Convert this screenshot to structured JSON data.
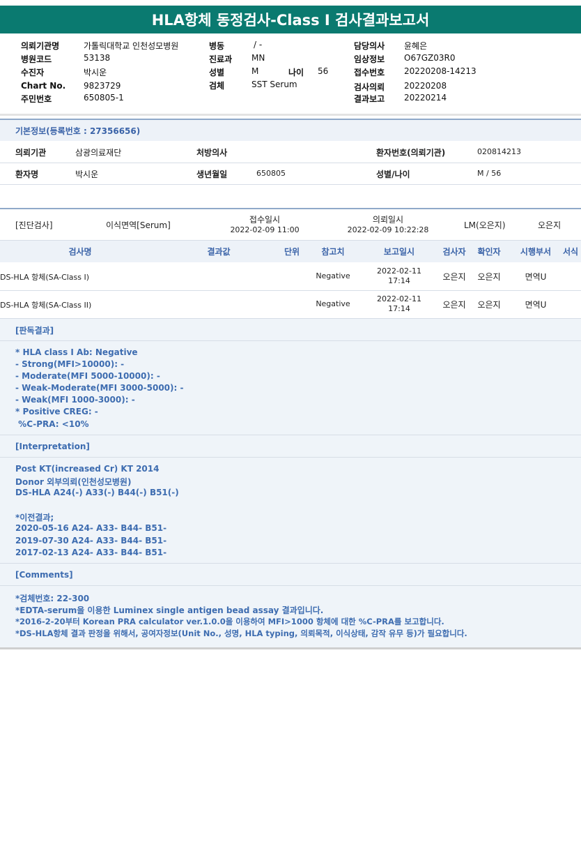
{
  "title": "HLA항체 동정검사-Class I 검사결과보고서",
  "header": {
    "col1": [
      {
        "label": "의뢰기관명",
        "value": "가톨릭대학교 인천성모병원"
      },
      {
        "label": "병원코드",
        "value": "53138"
      },
      {
        "label": "수진자",
        "value": "박시운"
      },
      {
        "label": "Chart No.",
        "value": "9823729"
      },
      {
        "label": "주민번호",
        "value": "650805-1"
      }
    ],
    "col2": [
      {
        "label": "병동",
        "value": "/ -"
      },
      {
        "label": "진료과",
        "value": "MN"
      },
      {
        "label": "성별",
        "value": "M"
      },
      {
        "label": "검체",
        "value": "SST Serum"
      }
    ],
    "age": {
      "label": "나이",
      "value": "56"
    },
    "col3": [
      {
        "label": "담당의사",
        "value": "윤혜은"
      },
      {
        "label": "임상정보",
        "value": "O67GZ03R0"
      },
      {
        "label": "접수번호",
        "value": "20220208-14213"
      },
      {
        "label": "검사의뢰",
        "value": "20220208"
      },
      {
        "label": "결과보고",
        "value": "20220214"
      }
    ]
  },
  "basic": {
    "title": "기본정보(등록번호 : 27356656)",
    "row1": {
      "inst_label": "의뢰기관",
      "inst_value": "삼광의료재단",
      "doctor_label": "처방의사",
      "doctor_value": "",
      "pid_label": "환자번호(의뢰기관)",
      "pid_value": "020814213"
    },
    "row2": {
      "name_label": "환자명",
      "name_value": "박시운",
      "dob_label": "생년월일",
      "dob_value": "650805",
      "sex_label": "성별/나이",
      "sex_value": "M / 56"
    }
  },
  "exam_info": {
    "category": "[진단검사]",
    "dept": "이식면역[Serum]",
    "received_label": "접수일시",
    "received_value": "2022-02-09 11:00",
    "requested_label": "의뢰일시",
    "requested_value": "2022-02-09 10:22:28",
    "lm": "LM(오은지)",
    "person": "오은지"
  },
  "table": {
    "headers": {
      "name": "검사명",
      "result": "결과값",
      "unit": "단위",
      "ref": "참고치",
      "report": "보고일시",
      "tester": "검사자",
      "confirmer": "확인자",
      "dept": "시행부서",
      "form": "서식"
    },
    "rows": [
      {
        "name": "DS-HLA 항체(SA-Class I)",
        "result": "",
        "unit": "",
        "ref": "Negative",
        "date": "2022-02-11",
        "time": "17:14",
        "tester": "오은지",
        "confirmer": "오은지",
        "dept": "면역U"
      },
      {
        "name": "DS-HLA 항체(SA-Class II)",
        "result": "",
        "unit": "",
        "ref": "Negative",
        "date": "2022-02-11",
        "time": "17:14",
        "tester": "오은지",
        "confirmer": "오은지",
        "dept": "면역U"
      }
    ]
  },
  "judgement": {
    "title": "[판독결과]",
    "lines": [
      "* HLA class I Ab: Negative",
      "- Strong(MFI>10000): -",
      "- Moderate(MFI 5000-10000): -",
      "- Weak-Moderate(MFI 3000-5000): -",
      "- Weak(MFI 1000-3000): -",
      "* Positive CREG: -",
      " %C-PRA: <10%"
    ]
  },
  "interpretation": {
    "title": "[Interpretation]",
    "lines": [
      "Post KT(increased Cr) KT 2014",
      "Donor 외부의뢰(인천성모병원)",
      "DS-HLA A24(-) A33(-) B44(-) B51(-)",
      "*이전결과;",
      "2020-05-16 A24- A33- B44- B51-",
      "2019-07-30 A24- A33- B44- B51-",
      "2017-02-13 A24- A33- B44- B51-"
    ]
  },
  "comments": {
    "title": "[Comments]",
    "lines": [
      "*검체번호: 22-300",
      "*EDTA-serum을 이용한 Luminex single antigen bead assay 결과입니다.",
      "*2016-2-20부터 Korean PRA calculator ver.1.0.0을 이용하여 MFI>1000 항체에 대한 %C-PRA를 보고합니다.",
      "*DS-HLA항체 결과 판정을 위해서, 공여자정보(Unit No., 성명, HLA typing, 의뢰목적, 이식상태, 감작 유무 등)가 필요합니다."
    ]
  }
}
